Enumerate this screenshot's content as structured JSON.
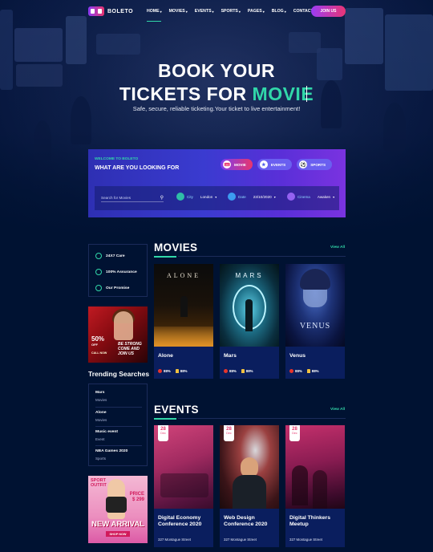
{
  "brand": {
    "name": "BOLETO"
  },
  "nav": {
    "items": [
      {
        "label": "HOME",
        "has_caret": true
      },
      {
        "label": "MOVIES",
        "has_caret": true
      },
      {
        "label": "EVENTS",
        "has_caret": true
      },
      {
        "label": "SPORTS",
        "has_caret": true
      },
      {
        "label": "PAGES",
        "has_caret": true
      },
      {
        "label": "BLOG",
        "has_caret": true
      },
      {
        "label": "CONTACT",
        "has_caret": false
      }
    ],
    "join_label": "JOIN US"
  },
  "hero": {
    "line1": "BOOK YOUR",
    "line2_prefix": "TICKETS FOR",
    "line2_accent": "MOVIE",
    "subtitle": "Safe, secure, reliable ticketing.Your ticket to live entertainment!"
  },
  "search": {
    "welcome": "WELCOME TO BOLETO",
    "heading": "WHAT ARE YOU LOOKING FOR",
    "tabs": [
      {
        "label": "MOVIE",
        "active": true
      },
      {
        "label": "EVENTS",
        "active": false
      },
      {
        "label": "SPORTS",
        "active": false
      }
    ],
    "input_placeholder": "Search for Movies",
    "city": {
      "label": "City",
      "value": "London"
    },
    "date": {
      "label": "Date",
      "value": "23/10/2020"
    },
    "cinema": {
      "label": "Cinema",
      "value": "Awaken"
    }
  },
  "sidebar": {
    "features": [
      "24X7 Care",
      "100% Assurance",
      "Our Promise"
    ],
    "ad1": {
      "percent": "50%",
      "off": "OFF",
      "call": "CALL NOW",
      "phone": "$$$ $$$$",
      "cta": "BE STRONG COME AND JOIN US"
    },
    "trending_title": "Trending Searches",
    "trending": [
      {
        "name": "Mars",
        "category": "Movies"
      },
      {
        "name": "Alone",
        "category": "Movies"
      },
      {
        "name": "Music event",
        "category": "Event"
      },
      {
        "name": "NBA Games 2020",
        "category": "Sports"
      }
    ],
    "ad2": {
      "sport": "SPORT",
      "outfit": "OUTFIT",
      "price_label": "PRICE",
      "price": "$ 299",
      "headline": "NEW ARRIVAL",
      "shop": "SHOP NOW"
    }
  },
  "movies": {
    "title": "MOVIES",
    "view_all": "View All",
    "items": [
      {
        "name": "Alone",
        "poster_title": "ALONE",
        "tomato": "88%",
        "audience": "88%"
      },
      {
        "name": "Mars",
        "poster_title": "MARS",
        "tomato": "88%",
        "audience": "88%"
      },
      {
        "name": "Venus",
        "poster_title": "VENUS",
        "tomato": "88%",
        "audience": "88%"
      }
    ]
  },
  "events": {
    "title": "EVENTS",
    "view_all": "View All",
    "items": [
      {
        "day": "28",
        "month": "Dec",
        "name": "Digital Economy Conference 2020",
        "location": "327 Montague Street"
      },
      {
        "day": "28",
        "month": "Dec",
        "name": "Web Design Conference 2020",
        "location": "327 Montague Street"
      },
      {
        "day": "28",
        "month": "Dec",
        "name": "Digital Thinkers Meetup",
        "location": "327 Montague Street"
      }
    ]
  },
  "colors": {
    "accent": "#31d7a9",
    "background": "#001232",
    "card": "#0a1e5e",
    "gradient_start": "#9b3df5",
    "gradient_end": "#e83575"
  }
}
